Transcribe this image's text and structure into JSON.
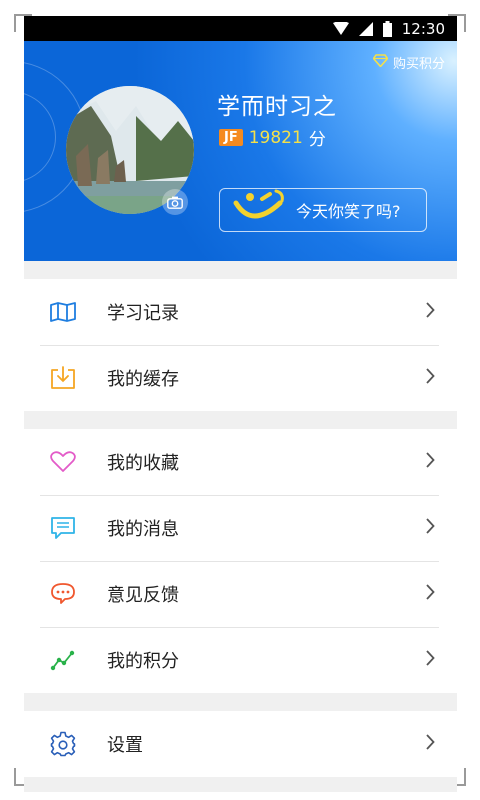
{
  "status_bar": {
    "time": "12:30"
  },
  "header": {
    "buy_points": "购买积分",
    "username": "学而时习之",
    "jf_badge": "JF",
    "points": "19821",
    "points_unit": "分",
    "mood_prompt": "今天你笑了吗?"
  },
  "menu_groups": [
    {
      "items": [
        {
          "label": "学习记录",
          "icon": "map-icon",
          "color": "#1f7ee0"
        },
        {
          "label": "我的缓存",
          "icon": "download-icon",
          "color": "#f5a623"
        }
      ]
    },
    {
      "items": [
        {
          "label": "我的收藏",
          "icon": "heart-icon",
          "color": "#e35bc8"
        },
        {
          "label": "我的消息",
          "icon": "message-icon",
          "color": "#2fb4e8"
        },
        {
          "label": "意见反馈",
          "icon": "feedback-icon",
          "color": "#f0572e"
        },
        {
          "label": "我的积分",
          "icon": "points-chart-icon",
          "color": "#29b24a"
        }
      ]
    },
    {
      "items": [
        {
          "label": "设置",
          "icon": "gear-icon",
          "color": "#2a5fb8"
        }
      ]
    }
  ]
}
